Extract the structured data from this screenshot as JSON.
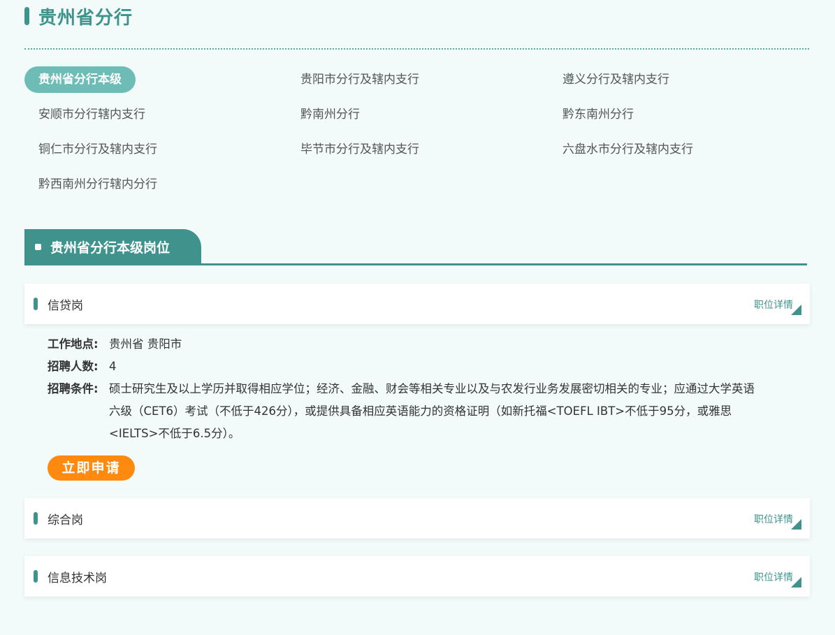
{
  "header": {
    "title": "贵州省分行"
  },
  "branches": [
    "贵州省分行本级",
    "贵阳市分行及辖内支行",
    "遵义分行及辖内支行",
    "安顺市分行辖内支行",
    "黔南州分行",
    "黔东南州分行",
    "铜仁市分行及辖内支行",
    "毕节市分行及辖内支行",
    "六盘水市分行及辖内支行",
    "黔西南州分行辖内分行"
  ],
  "section": {
    "title": "贵州省分行本级岗位"
  },
  "jobs": [
    {
      "title": "信贷岗",
      "detail_link": "职位详情",
      "location_label": "工作地点:",
      "location": "贵州省 贵阳市",
      "count_label": "招聘人数:",
      "count": "4",
      "req_label": "招聘条件:",
      "requirements": "硕士研究生及以上学历并取得相应学位；经济、金融、财会等相关专业以及与农发行业务发展密切相关的专业；应通过大学英语六级（CET6）考试（不低于426分），或提供具备相应英语能力的资格证明（如新托福<TOEFL IBT>不低于95分，或雅思<IELTS>不低于6.5分）。",
      "apply_label": "立即申请"
    },
    {
      "title": "综合岗",
      "detail_link": "职位详情"
    },
    {
      "title": "信息技术岗",
      "detail_link": "职位详情"
    }
  ],
  "colors": {
    "accent": "#3f938c",
    "active_pill": "#6dbdb6",
    "apply": "#ff8a0f"
  }
}
